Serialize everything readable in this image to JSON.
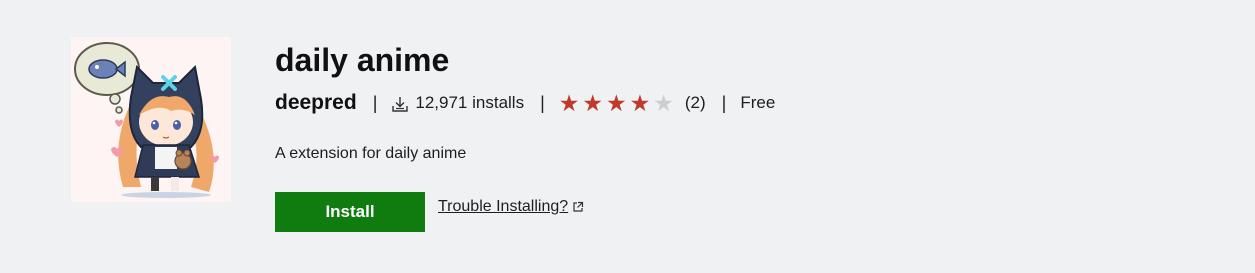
{
  "extension": {
    "name": "daily anime",
    "publisher": "deepred",
    "installs": "12,971 installs",
    "rating": 4,
    "rating_max": 5,
    "rating_count": "(2)",
    "price": "Free",
    "description": "A extension for daily anime"
  },
  "actions": {
    "install_label": "Install",
    "trouble_label": "Trouble Installing?"
  },
  "separators": {
    "s1": "|",
    "s2": "|",
    "s3": "|"
  },
  "colors": {
    "install_button": "#107c10",
    "star_filled": "#c0392b",
    "star_empty": "#cfcfcf",
    "background": "#f0f1f3"
  },
  "icons": {
    "logo": "anime-girl-logo",
    "installs": "download-icon",
    "external": "external-link-icon",
    "star": "star-icon"
  }
}
